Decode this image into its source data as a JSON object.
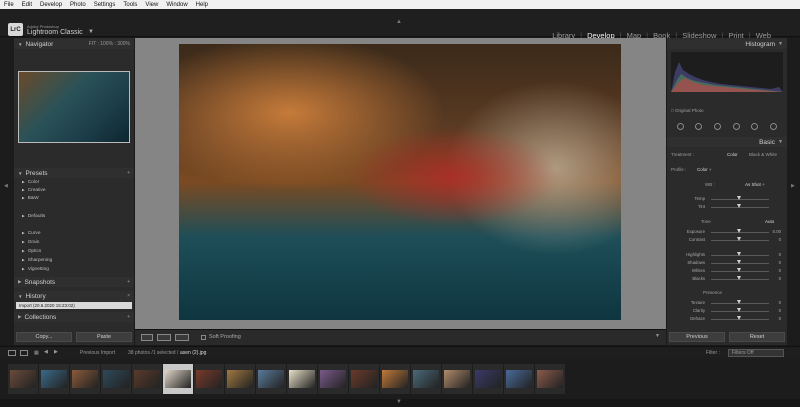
{
  "menu": [
    "File",
    "Edit",
    "Develop",
    "Photo",
    "Settings",
    "Tools",
    "View",
    "Window",
    "Help"
  ],
  "identity": {
    "logo": "LrC",
    "brand_small": "Adobe Photoshop",
    "brand_large": "Lightroom Classic",
    "brand_caret": "▼"
  },
  "modules": [
    "Library",
    "Develop",
    "Map",
    "Book",
    "Slideshow",
    "Print",
    "Web"
  ],
  "active_module": "Develop",
  "left": {
    "navigator": {
      "title": "Navigator",
      "fit": "FIT",
      "z1": "100%",
      "z2": "300%"
    },
    "presets": {
      "title": "Presets",
      "items": [
        "Color",
        "Creative",
        "B&W",
        "Defaults",
        "Curve",
        "Grain",
        "Optics",
        "Sharpening",
        "Vignetting"
      ]
    },
    "snapshots": {
      "title": "Snapshots"
    },
    "history": {
      "title": "History",
      "close": "×",
      "row": "Import (20.6.2020 15:23:02)"
    },
    "collections": {
      "title": "Collections"
    },
    "copy": "Copy...",
    "paste": "Paste"
  },
  "toolbar": {
    "soft_proofing": "Soft Proofing"
  },
  "right": {
    "histogram": {
      "title": "Histogram",
      "original_photo": "Original Photo"
    },
    "basic": {
      "title": "Basic",
      "treatment_label": "Treatment :",
      "color": "Color",
      "bw": "Black & White",
      "profile_label": "Profile :",
      "profile_value": "Color ÷",
      "wb_label": "WB :",
      "wb_value": "As Shot ÷",
      "tone": "Tone",
      "auto": "Auto",
      "presence": "Presence",
      "sliders": [
        {
          "label": "Temp",
          "value": ""
        },
        {
          "label": "Tint",
          "value": ""
        },
        {
          "label": "Exposure",
          "value": "0.00"
        },
        {
          "label": "Contrast",
          "value": "0"
        },
        {
          "label": "Highlights",
          "value": "0"
        },
        {
          "label": "Shadows",
          "value": "0"
        },
        {
          "label": "Whites",
          "value": "0"
        },
        {
          "label": "Blacks",
          "value": "0"
        },
        {
          "label": "Texture",
          "value": "0"
        },
        {
          "label": "Clarity",
          "value": "0"
        },
        {
          "label": "Dehaze",
          "value": "0"
        }
      ]
    },
    "previous": "Previous",
    "reset": "Reset"
  },
  "filmstrip": {
    "source": "Previous Import",
    "count": "38 photos /1 selected /",
    "filename": "asen (2).jpg",
    "filter_label": "Filter :",
    "filter_value": "Filters Off",
    "thumb_count": 18,
    "selected_index": 5,
    "colors": [
      "#6b4a3a",
      "#3a6a8a",
      "#8a5a3a",
      "#2e4a5a",
      "#5a3a2a",
      "#e0d6c8",
      "#7a3a2a",
      "#a07840",
      "#5a7a9a",
      "#e8e0c8",
      "#7a5a8a",
      "#6a3a2a",
      "#c07a3a",
      "#4a6a7a",
      "#b08a6a",
      "#3a3a6a",
      "#4a6a9a",
      "#8a5a4a"
    ]
  }
}
